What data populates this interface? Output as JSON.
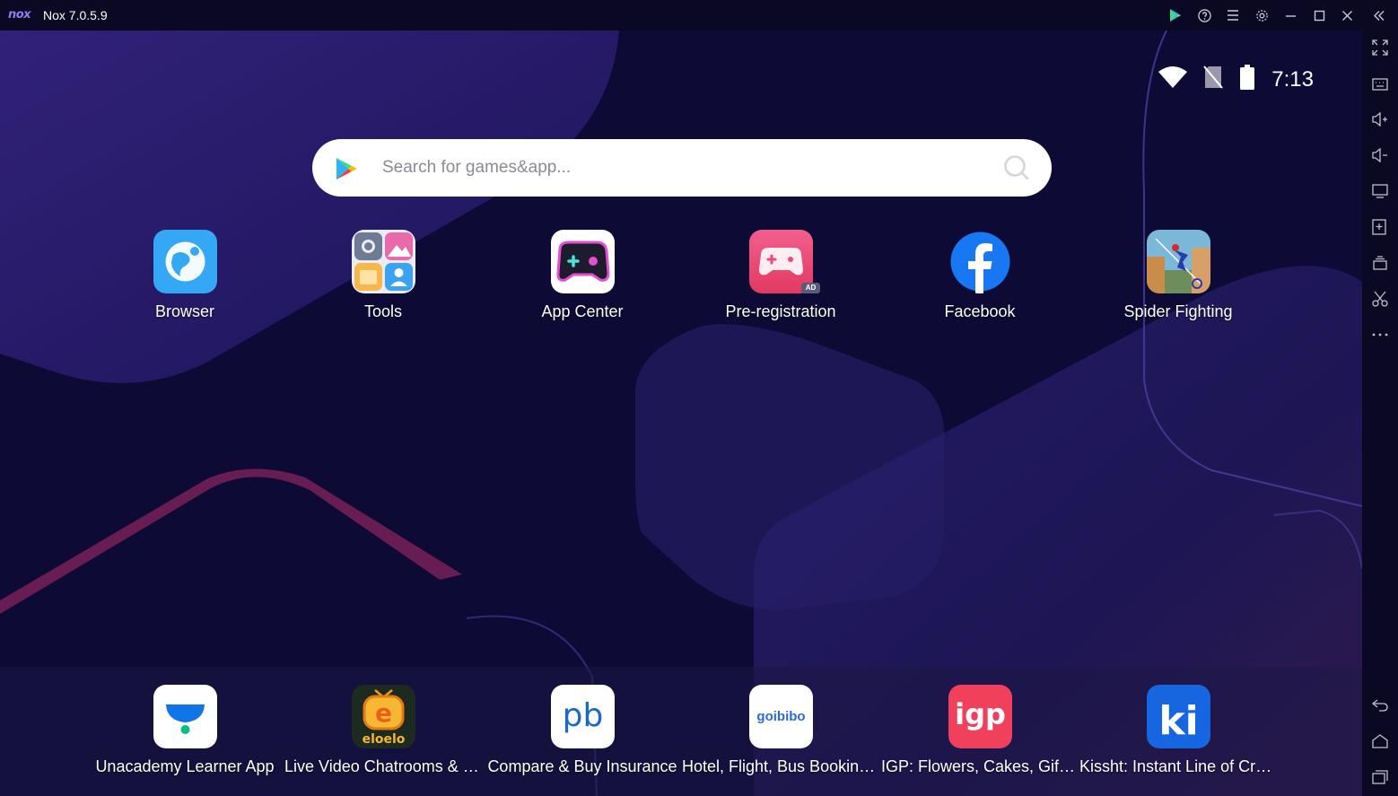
{
  "window": {
    "logo_text": "nox",
    "title": "Nox 7.0.5.9",
    "controls": [
      "play-store-icon",
      "help-icon",
      "menu-icon",
      "settings-icon",
      "minimize-icon",
      "maximize-icon",
      "close-icon",
      "collapse-sidebar-icon"
    ]
  },
  "status_bar": {
    "time": "7:13",
    "icons": [
      "wifi-icon",
      "no-sim-icon",
      "battery-icon"
    ]
  },
  "search": {
    "placeholder": "Search for games&app..."
  },
  "apps": [
    {
      "label": "Browser",
      "icon": "browser-icon"
    },
    {
      "label": "Tools",
      "icon": "tools-icon"
    },
    {
      "label": "App Center",
      "icon": "app-center-icon"
    },
    {
      "label": "Pre-registration",
      "icon": "pre-registration-icon",
      "badge": "AD"
    },
    {
      "label": "Facebook",
      "icon": "facebook-icon"
    },
    {
      "label": "Spider Fighting",
      "icon": "spider-fighting-icon"
    }
  ],
  "dock": [
    {
      "label": "Unacademy Learner App",
      "icon": "unacademy-icon"
    },
    {
      "label": "Live Video Chatrooms & Ga..",
      "icon": "eloelo-icon",
      "icon_text": "eloelo"
    },
    {
      "label": "Compare & Buy Insurance",
      "icon": "policybazaar-icon",
      "icon_text": "pb"
    },
    {
      "label": "Hotel, Flight, Bus Booking A..",
      "icon": "goibibo-icon",
      "icon_text": "goibibo"
    },
    {
      "label": "IGP: Flowers, Cakes, Gifts A..",
      "icon": "igp-icon",
      "icon_text": "igp"
    },
    {
      "label": "Kissht: Instant Line of Credit",
      "icon": "kissht-icon",
      "icon_text": "ki"
    }
  ],
  "sidebar": [
    "fullscreen-icon",
    "keyboard-icon",
    "volume-up-icon",
    "volume-down-icon",
    "screen-icon",
    "add-apk-icon",
    "multi-instance-icon",
    "screenshot-icon",
    "more-icon",
    "back-icon",
    "home-icon",
    "recents-icon"
  ],
  "colors": {
    "background": "#0d0a35",
    "titlebar": "#0a0822",
    "accent": "#8c7cf0"
  }
}
